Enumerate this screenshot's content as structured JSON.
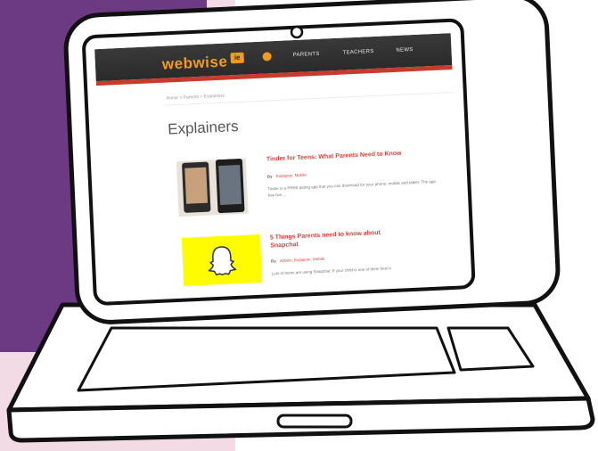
{
  "site": {
    "logo_text": "webwise",
    "logo_badge": "ie",
    "nav": [
      "PARENTS",
      "TEACHERS",
      "NEWS"
    ],
    "accent_color": "#d9413a",
    "logo_color": "#f29b1c"
  },
  "breadcrumb": "Home > Parents > Explainers",
  "page_title": "Explainers",
  "articles": [
    {
      "title": "Tinder for Teens: What Parents Need to Know",
      "by": "By",
      "meta": "Explainer, Mobile",
      "excerpt": "Tinder is a FREE dating app that you can download for your phone, mobile and tablet. The app has two ...",
      "thumbnail": "phones-icon"
    },
    {
      "title_line1": "5 Things Parents need to know about",
      "title_line2": "Snapchat",
      "by": "By",
      "meta": "Advice, Explainer, Mobile",
      "excerpt": "Lots of teens are using Snapchat. If your child is one of them here's",
      "thumbnail": "snapchat-ghost-icon"
    }
  ]
}
